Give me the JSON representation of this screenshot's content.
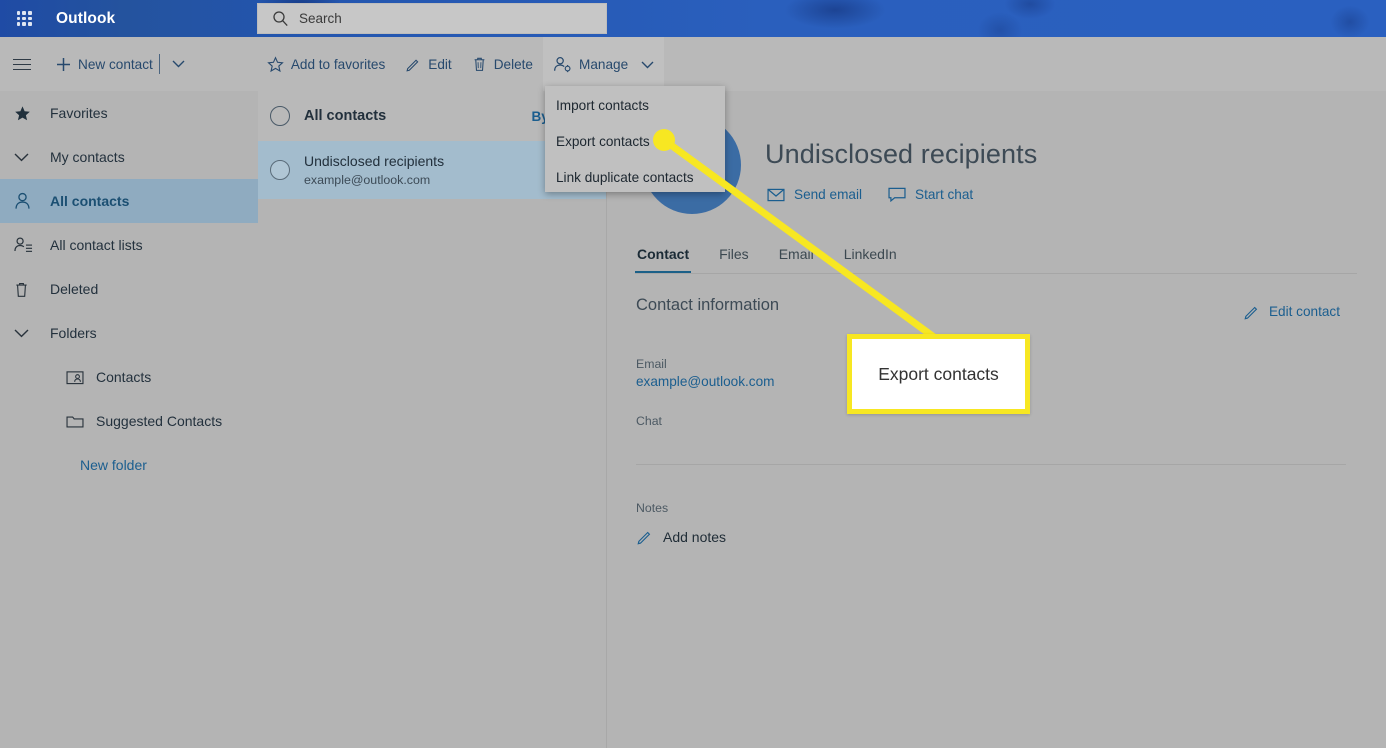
{
  "topbar": {
    "waffle_icon": "app-launcher-grid-icon",
    "brand": "Outlook",
    "search": {
      "icon": "search-icon",
      "placeholder": "Search",
      "value": ""
    }
  },
  "commandbar": {
    "hamburger_icon": "hamburger-menu-icon",
    "new_contact": {
      "icon": "plus-icon",
      "label": "New contact",
      "caret_icon": "chevron-down-icon"
    },
    "items": [
      {
        "icon": "star-outline-icon",
        "label": "Add to favorites"
      },
      {
        "icon": "pencil-icon",
        "label": "Edit"
      },
      {
        "icon": "trash-icon",
        "label": "Delete"
      }
    ],
    "manage": {
      "icon": "person-settings-icon",
      "label": "Manage",
      "caret_icon": "chevron-down-icon"
    }
  },
  "dropdown": {
    "items": [
      {
        "label": "Import contacts"
      },
      {
        "label": "Export contacts"
      },
      {
        "label": "Link duplicate contacts"
      }
    ]
  },
  "sidebar": {
    "items": [
      {
        "label": "Favorites",
        "icon": "star-filled-icon"
      },
      {
        "label": "My contacts",
        "icon": "chevron-down-icon"
      },
      {
        "label": "All contacts",
        "icon": "person-icon"
      },
      {
        "label": "All contact lists",
        "icon": "people-list-icon"
      },
      {
        "label": "Deleted",
        "icon": "trash-icon"
      },
      {
        "label": "Folders",
        "icon": "chevron-down-icon"
      },
      {
        "label": "Contacts",
        "icon": "contact-card-icon"
      },
      {
        "label": "Suggested Contacts",
        "icon": "folder-icon"
      },
      {
        "label": "New folder",
        "icon": "none"
      }
    ]
  },
  "list": {
    "header": {
      "title": "All contacts",
      "sort": "By first n"
    },
    "rows": [
      {
        "name": "Undisclosed recipients",
        "email": "example@outlook.com"
      }
    ]
  },
  "detail": {
    "name": "Undisclosed recipients",
    "actions": [
      {
        "icon": "envelope-icon",
        "label": "Send email"
      },
      {
        "icon": "chat-bubble-icon",
        "label": "Start chat"
      }
    ],
    "tabs": [
      {
        "label": "Contact",
        "active": true
      },
      {
        "label": "Files",
        "active": false
      },
      {
        "label": "Email",
        "active": false
      },
      {
        "label": "LinkedIn",
        "active": false
      }
    ],
    "section_title": "Contact information",
    "edit_contact": {
      "icon": "pencil-icon",
      "label": "Edit contact"
    },
    "fields": [
      {
        "key": "Email",
        "value": "example@outlook.com"
      },
      {
        "key": "Chat",
        "value": ""
      }
    ],
    "notes": {
      "key": "Notes",
      "add_label": "Add notes",
      "icon": "pencil-icon"
    }
  },
  "annotation": {
    "callout_label": "Export contacts",
    "highlight_color": "#f7e722"
  }
}
